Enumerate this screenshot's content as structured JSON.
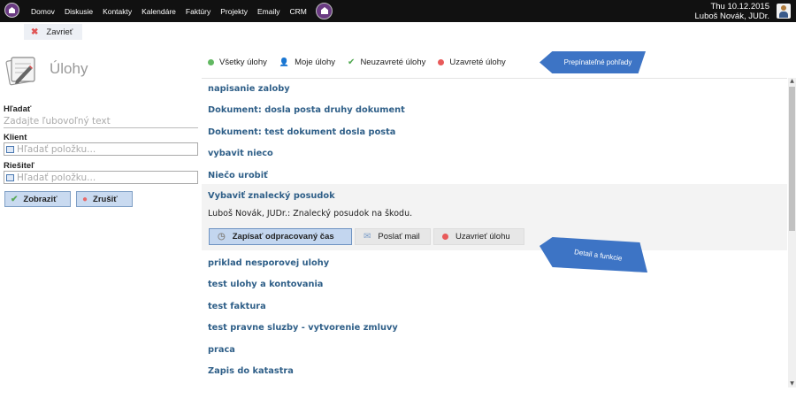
{
  "topbar": {
    "nav": [
      "Domov",
      "Diskusie",
      "Kontakty",
      "Kalendáre",
      "Faktúry",
      "Projekty",
      "Emaily",
      "CRM"
    ],
    "date": "Thu 10.12.2015",
    "user": "Luboš Novák, JUDr."
  },
  "close_tab": "Zavrieť",
  "page_title": "Úlohy",
  "search": {
    "label": "Hľadať",
    "placeholder": "Zadajte ľubovoľný text",
    "client_label": "Klient",
    "client_placeholder": "Hľadať položku...",
    "solver_label": "Riešiteľ",
    "solver_placeholder": "Hľadať položku...",
    "show_button": "Zobraziť",
    "cancel_button": "Zrušiť"
  },
  "filters": [
    "Všetky úlohy",
    "Moje úlohy",
    "Neuzavreté úlohy",
    "Uzavreté úlohy"
  ],
  "callouts": {
    "views": "Prepínateľné pohľady",
    "detail": "Detail a funkcie"
  },
  "tasks": [
    "napisanie zaloby",
    "Dokument: dosla posta druhy dokument",
    "Dokument: test dokument dosla posta",
    "vybavit nieco",
    "Niečo urobiť",
    "Vybaviť znalecký posudok",
    "priklad nesporovej ulohy",
    "test ulohy a kontovania",
    "test faktura",
    "test pravne sluzby - vytvorenie zmluvy",
    "praca",
    "Zapis do katastra"
  ],
  "detail": {
    "text": "Luboš Novák, JUDr.: Znalecký posudok na škodu.",
    "buttons": [
      "Zapísať odpracovaný čas",
      "Poslať mail",
      "Uzavrieť úlohu"
    ]
  },
  "colors": {
    "topbar": "#111111",
    "link": "#2f5f88",
    "callout": "#3d74c5",
    "button": "#c9daf0"
  }
}
